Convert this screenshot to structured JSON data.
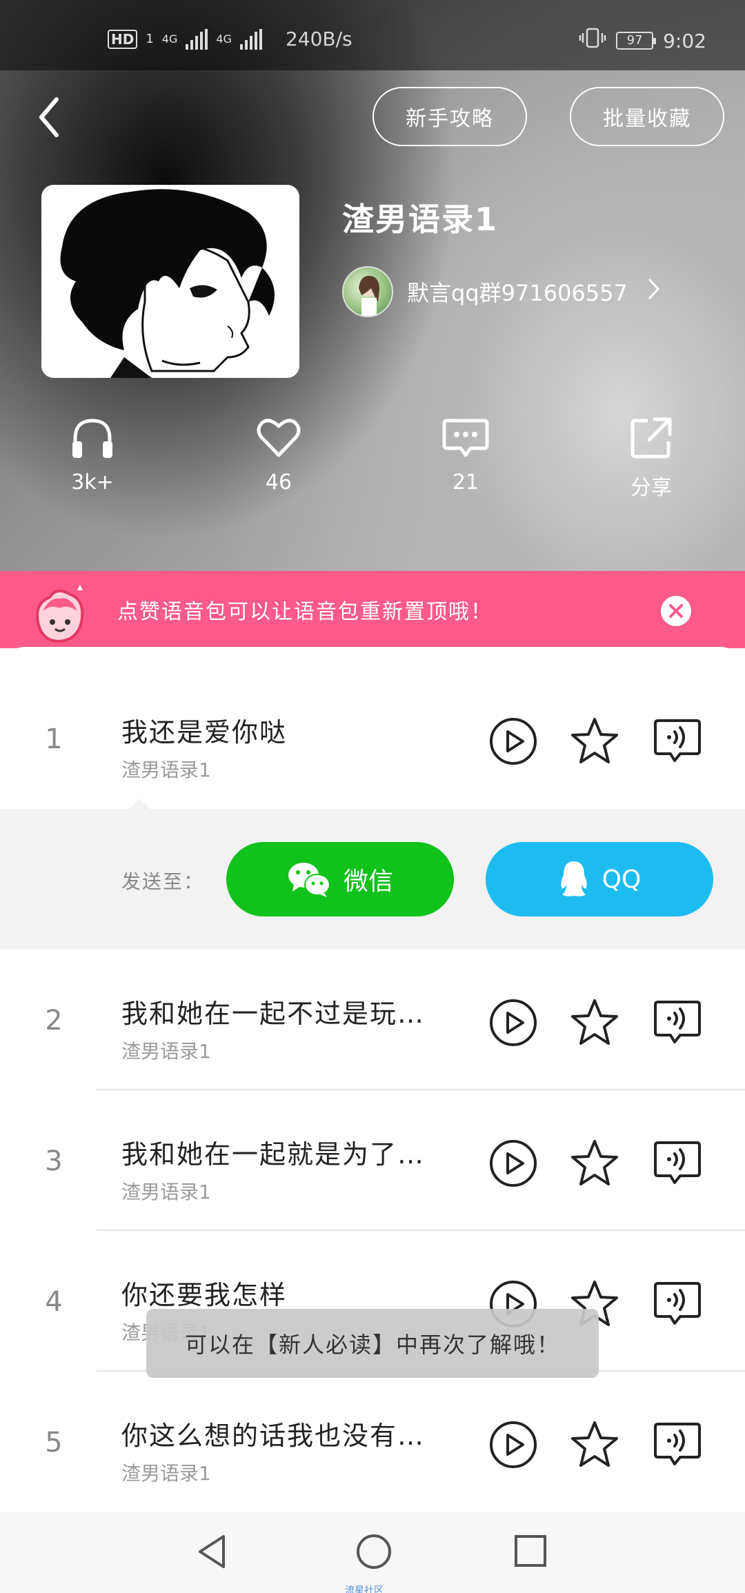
{
  "status_bar": {
    "hd": "HD",
    "sim": "1",
    "net1": "4G",
    "net2": "4G",
    "speed": "240B/s",
    "battery": "97",
    "time": "9:02"
  },
  "header": {
    "guide_label": "新手攻略",
    "batch_label": "批量收藏"
  },
  "album": {
    "title": "渣男语录1",
    "author": "默言qq群971606557"
  },
  "stats": [
    {
      "icon": "headphones-icon",
      "value": "3k+"
    },
    {
      "icon": "heart-icon",
      "value": "46"
    },
    {
      "icon": "comment-icon",
      "value": "21"
    },
    {
      "icon": "share-icon",
      "value": "分享"
    }
  ],
  "banner": {
    "text": "点赞语音包可以让语音包重新置顶哦！"
  },
  "send_panel": {
    "label": "发送至：",
    "wechat": "微信",
    "qq": "QQ"
  },
  "items": [
    {
      "num": "1",
      "title": "我还是爱你哒",
      "sub": "渣男语录1"
    },
    {
      "num": "2",
      "title": "我和她在一起不过是玩…",
      "sub": "渣男语录1"
    },
    {
      "num": "3",
      "title": "我和她在一起就是为了…",
      "sub": "渣男语录1"
    },
    {
      "num": "4",
      "title": "你还要我怎样",
      "sub": "渣男语录1"
    },
    {
      "num": "5",
      "title": "你这么想的话我也没有…",
      "sub": "渣男语录1"
    }
  ],
  "toast": "可以在【新人必读】中再次了解哦！",
  "navbar": {
    "caption": "流星社区"
  },
  "colors": {
    "banner_pink": "#fb5a8b",
    "wechat_green": "#10c21a",
    "qq_blue": "#1dbcf0"
  }
}
